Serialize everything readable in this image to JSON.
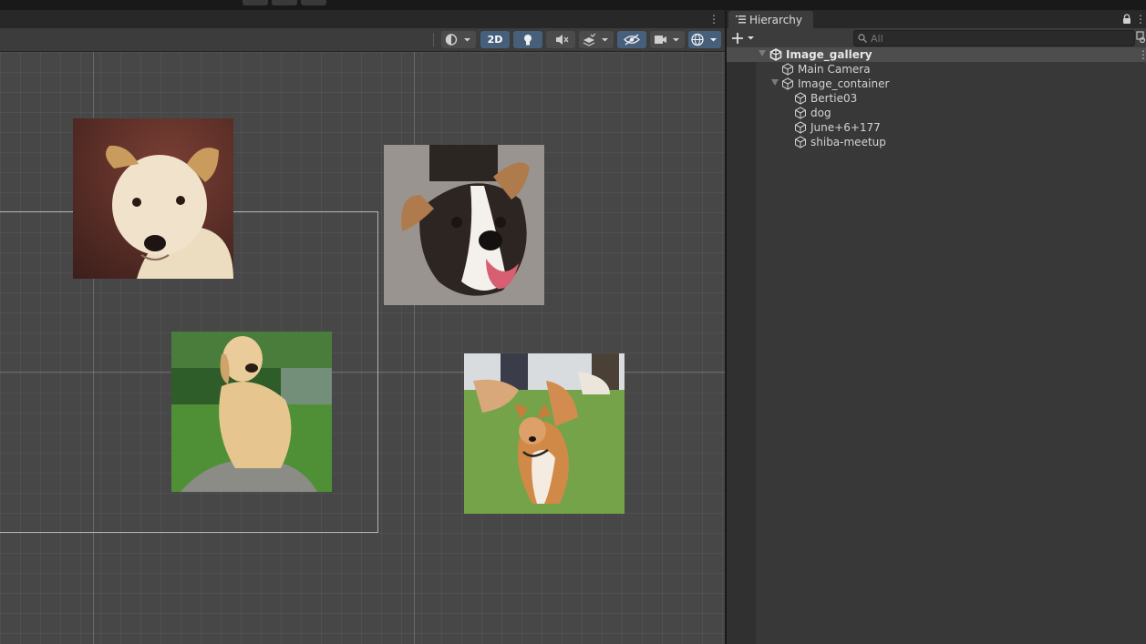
{
  "scene_view": {
    "toolbar": {
      "mode_2d_label": "2D"
    }
  },
  "hierarchy": {
    "tab_label": "Hierarchy",
    "search": {
      "placeholder": "All"
    },
    "scene_name": "Image_gallery",
    "items": [
      {
        "label": "Main Camera"
      },
      {
        "label": "Image_container"
      },
      {
        "label": "Bertie03"
      },
      {
        "label": "dog"
      },
      {
        "label": "June+6+177"
      },
      {
        "label": "shiba-meetup"
      }
    ]
  },
  "colors": {
    "scene_background": "#474747",
    "panel_background": "#383838",
    "active_toggle": "#46607c"
  }
}
